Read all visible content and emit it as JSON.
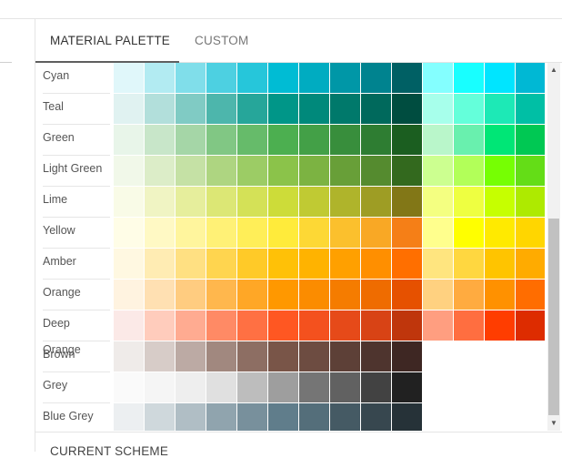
{
  "tabs": [
    {
      "label": "MATERIAL PALETTE",
      "active": true
    },
    {
      "label": "CUSTOM",
      "active": false
    }
  ],
  "section_heading": "CURRENT SCHEME",
  "palette": [
    {
      "name": "Cyan",
      "colors": [
        "#e0f7fa",
        "#b2ebf2",
        "#80deea",
        "#4dd0e1",
        "#26c6da",
        "#00bcd4",
        "#00acc1",
        "#0097a7",
        "#00838f",
        "#006064",
        "#84ffff",
        "#18ffff",
        "#00e5ff",
        "#00b8d4"
      ]
    },
    {
      "name": "Teal",
      "colors": [
        "#e0f2f1",
        "#b2dfdb",
        "#80cbc4",
        "#4db6ac",
        "#26a69a",
        "#009688",
        "#00897b",
        "#00796b",
        "#00695c",
        "#004d40",
        "#a7ffeb",
        "#64ffda",
        "#1de9b6",
        "#00bfa5"
      ]
    },
    {
      "name": "Green",
      "colors": [
        "#e8f5e9",
        "#c8e6c9",
        "#a5d6a7",
        "#81c784",
        "#66bb6a",
        "#4caf50",
        "#43a047",
        "#388e3c",
        "#2e7d32",
        "#1b5e20",
        "#b9f6ca",
        "#69f0ae",
        "#00e676",
        "#00c853"
      ]
    },
    {
      "name": "Light Green",
      "colors": [
        "#f1f8e9",
        "#dcedc8",
        "#c5e1a5",
        "#aed581",
        "#9ccc65",
        "#8bc34a",
        "#7cb342",
        "#689f38",
        "#558b2f",
        "#33691e",
        "#ccff90",
        "#b2ff59",
        "#76ff03",
        "#64dd17"
      ]
    },
    {
      "name": "Lime",
      "colors": [
        "#f9fbe7",
        "#f0f4c3",
        "#e6ee9c",
        "#dce775",
        "#d4e157",
        "#cddc39",
        "#c0ca33",
        "#afb42b",
        "#9e9d24",
        "#827717",
        "#f4ff81",
        "#eeff41",
        "#c6ff00",
        "#aeea00"
      ]
    },
    {
      "name": "Yellow",
      "colors": [
        "#fffde7",
        "#fff9c4",
        "#fff59d",
        "#fff176",
        "#ffee58",
        "#ffeb3b",
        "#fdd835",
        "#fbc02d",
        "#f9a825",
        "#f57f17",
        "#ffff8d",
        "#ffff00",
        "#ffea00",
        "#ffd600"
      ]
    },
    {
      "name": "Amber",
      "colors": [
        "#fff8e1",
        "#ffecb3",
        "#ffe082",
        "#ffd54f",
        "#ffca28",
        "#ffc107",
        "#ffb300",
        "#ffa000",
        "#ff8f00",
        "#ff6f00",
        "#ffe57f",
        "#ffd740",
        "#ffc400",
        "#ffab00"
      ]
    },
    {
      "name": "Orange",
      "colors": [
        "#fff3e0",
        "#ffe0b2",
        "#ffcc80",
        "#ffb74d",
        "#ffa726",
        "#ff9800",
        "#fb8c00",
        "#f57c00",
        "#ef6c00",
        "#e65100",
        "#ffd180",
        "#ffab40",
        "#ff9100",
        "#ff6d00"
      ]
    },
    {
      "name": "Deep Orange",
      "colors": [
        "#fbe9e7",
        "#ffccbc",
        "#ffab91",
        "#ff8a65",
        "#ff7043",
        "#ff5722",
        "#f4511e",
        "#e64a19",
        "#d84315",
        "#bf360c",
        "#ff9e80",
        "#ff6e40",
        "#ff3d00",
        "#dd2c00"
      ]
    },
    {
      "name": "Brown",
      "colors": [
        "#efebe9",
        "#d7ccc8",
        "#bcaaa4",
        "#a1887f",
        "#8d6e63",
        "#795548",
        "#6d4c41",
        "#5d4037",
        "#4e342e",
        "#3e2723"
      ]
    },
    {
      "name": "Grey",
      "colors": [
        "#fafafa",
        "#f5f5f5",
        "#eeeeee",
        "#e0e0e0",
        "#bdbdbd",
        "#9e9e9e",
        "#757575",
        "#616161",
        "#424242",
        "#212121"
      ]
    },
    {
      "name": "Blue Grey",
      "colors": [
        "#eceff1",
        "#cfd8dc",
        "#b0bec5",
        "#90a4ae",
        "#78909c",
        "#607d8b",
        "#546e7a",
        "#455a64",
        "#37474f",
        "#263238"
      ]
    }
  ],
  "scrollbar": {
    "up_glyph": "▲",
    "down_glyph": "▼"
  }
}
